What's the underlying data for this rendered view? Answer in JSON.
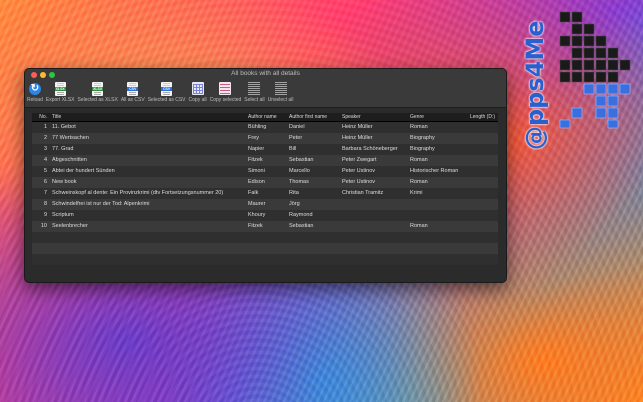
{
  "window": {
    "title": "All books with all details"
  },
  "toolbar": [
    {
      "label": "Reload",
      "icon": "reload-icon"
    },
    {
      "label": "Export XLSX",
      "icon": "xlsx-icon",
      "band": "XLSX",
      "color": "#2e8b3a"
    },
    {
      "label": "Selected as XLSX",
      "icon": "xlsx-icon",
      "band": "XLSX",
      "color": "#2e8b3a"
    },
    {
      "label": "All as CSV",
      "icon": "csv-icon",
      "band": "CSV",
      "color": "#2a6fd6"
    },
    {
      "label": "Selected as CSV",
      "icon": "csv-icon",
      "band": "CSV",
      "color": "#2a6fd6"
    },
    {
      "label": "Copy all",
      "icon": "copy-all-icon"
    },
    {
      "label": "Copy selected",
      "icon": "copy-selected-icon"
    },
    {
      "label": "Select all",
      "icon": "select-all-icon"
    },
    {
      "label": "Unselect all",
      "icon": "unselect-all-icon"
    }
  ],
  "table": {
    "headers": [
      "No.",
      "Title",
      "Author name",
      "Author first name",
      "Speaker",
      "Genre",
      "Length (D:)"
    ],
    "rows": [
      [
        "1",
        "11. Gebot",
        "Bühling",
        "Daniel",
        "Heinz Müller",
        "Roman",
        ""
      ],
      [
        "2",
        "77 Wertsachen",
        "Frey",
        "Peter",
        "Heinz Müller",
        "Biography",
        ""
      ],
      [
        "3",
        "77. Grad",
        "Napier",
        "Bill",
        "Barbara Schöneberger",
        "Biography",
        ""
      ],
      [
        "4",
        "Abgeschnitten",
        "Fitzek",
        "Sebastian",
        "Peter Zwegart",
        "Roman",
        ""
      ],
      [
        "5",
        "Abtei der hundert Sünden",
        "Simoni",
        "Marcello",
        "Peter Ustinov",
        "Historischer Roman",
        ""
      ],
      [
        "6",
        "New book",
        "Edison",
        "Thomas",
        "Peter Ustinov",
        "Roman",
        ""
      ],
      [
        "7",
        "Schweinskopf al dente: Ein Provinzkrimi (dtv Fortsetzungsnummer 20)",
        "Falk",
        "Rita",
        "Christian Tramitz",
        "Krimi",
        ""
      ],
      [
        "8",
        "Schwindelfrei ist nur der Tod: Alpenkrimi",
        "Maurer",
        "Jörg",
        "",
        "",
        ""
      ],
      [
        "9",
        "Scriptum",
        "Khoury",
        "Raymond",
        "",
        "",
        ""
      ],
      [
        "10",
        "Seelenbrecher",
        "Fitzek",
        "Sebastian",
        "",
        "Roman",
        ""
      ]
    ],
    "empty_rows": 3
  },
  "logo": {
    "text": "@pps4Me"
  }
}
